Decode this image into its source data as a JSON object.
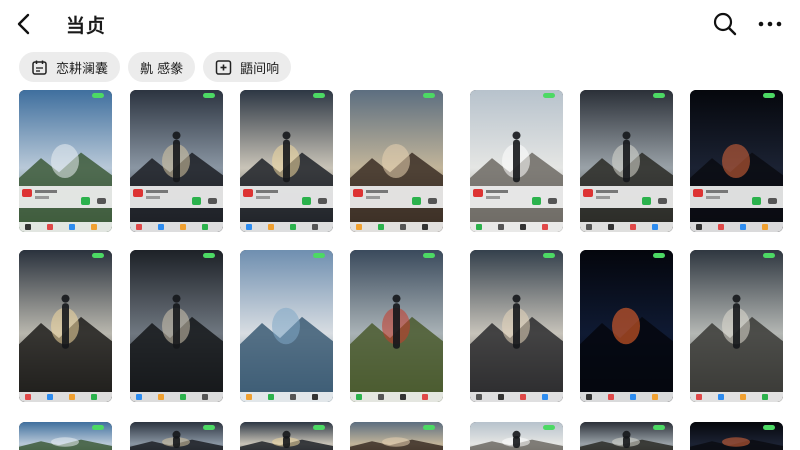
{
  "header": {
    "title": "当贞",
    "back_icon": "back-arrow-icon",
    "search_icon": "search-icon",
    "more_icon": "more-icon"
  },
  "chips": [
    {
      "label": "恋耕澜囊",
      "icon": "calendar-icon"
    },
    {
      "label": "鼽 感豢",
      "icon": ""
    },
    {
      "label": "鼯间响",
      "icon": "add-box-icon"
    }
  ],
  "wallpapers": [
    {
      "subject": "mountain valley with cloudy sky"
    },
    {
      "subject": "woman silhouette under dramatic sky"
    },
    {
      "subject": "person on boat facing radiant sky"
    },
    {
      "subject": "mountain peak at dusk"
    },
    {
      "subject": "flying vehicle over mountains"
    },
    {
      "subject": "lone figure under cloudy sky"
    },
    {
      "subject": "glowing planet with lightning"
    },
    {
      "subject": "person on boat under radiant sky"
    },
    {
      "subject": "woman silhouette at dusk"
    },
    {
      "subject": "mountain lake reflection"
    },
    {
      "subject": "man with red dragon wing"
    },
    {
      "subject": "woman walking on road"
    },
    {
      "subject": "neon light streaks on dark background"
    },
    {
      "subject": "man crouching under sky"
    }
  ],
  "colors": {
    "background": "#ffffff",
    "chip": "#ececec",
    "status_green": "#4cd964"
  }
}
